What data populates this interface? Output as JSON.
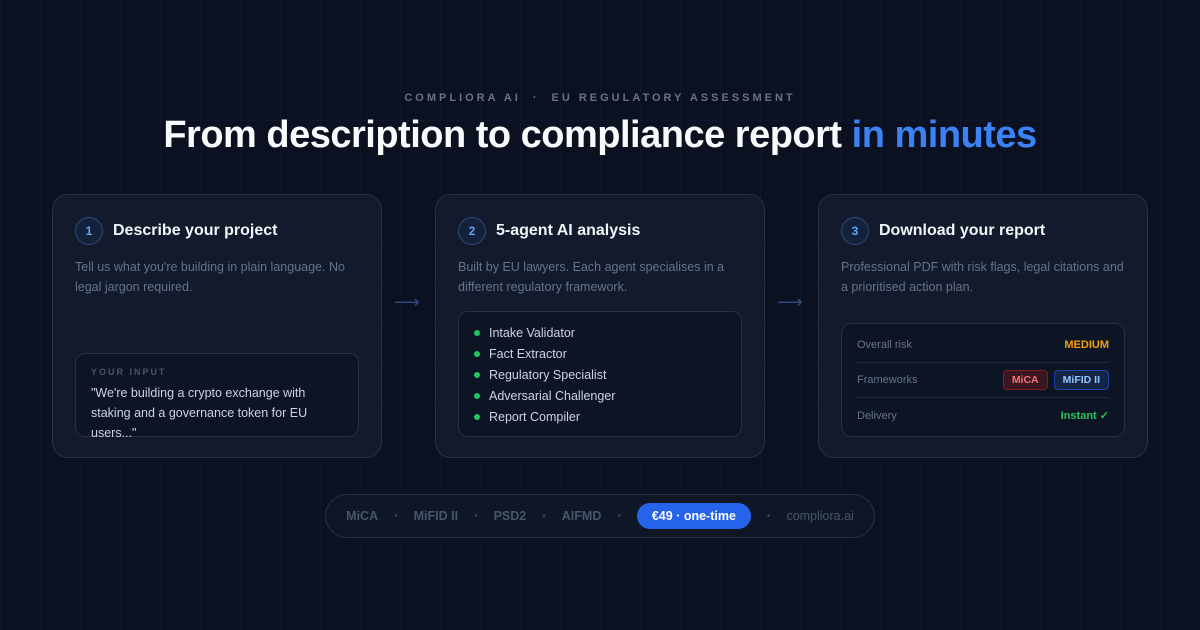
{
  "header": {
    "brand": "COMPLIORA AI",
    "separator": "·",
    "tagline": "EU REGULATORY ASSESSMENT",
    "headline_main": "From description to compliance report",
    "headline_accent": "in minutes"
  },
  "steps": [
    {
      "number": "1",
      "title": "Describe your project",
      "description": "Tell us what you're building in plain language. No legal jargon required.",
      "input_label": "YOUR INPUT",
      "input_text": "\"We're building a crypto exchange with staking and a governance token for EU users...\""
    },
    {
      "number": "2",
      "title": "5-agent AI analysis",
      "description": "Built by EU lawyers. Each agent specialises in a different regulatory framework.",
      "agents": [
        "Intake Validator",
        "Fact Extractor",
        "Regulatory Specialist",
        "Adversarial Challenger",
        "Report Compiler"
      ]
    },
    {
      "number": "3",
      "title": "Download your report",
      "description": "Professional PDF with risk flags, legal citations and a prioritised action plan.",
      "rows": {
        "risk_label": "Overall risk",
        "risk_value": "MEDIUM",
        "frameworks_label": "Frameworks",
        "framework_tags": [
          "MiCA",
          "MiFID II"
        ],
        "delivery_label": "Delivery",
        "delivery_value": "Instant ✓"
      }
    }
  ],
  "arrow": "⟶",
  "footer": {
    "frameworks": [
      "MiCA",
      "MiFID II",
      "PSD2",
      "AIFMD"
    ],
    "separator": "•",
    "price": "€49 · one-time",
    "domain": "compliora.ai"
  },
  "colors": {
    "background": "#0b1120",
    "accent": "#3b82f6",
    "risk_medium": "#f59e0b",
    "success": "#22c55e",
    "tag_red": "#f87171"
  }
}
